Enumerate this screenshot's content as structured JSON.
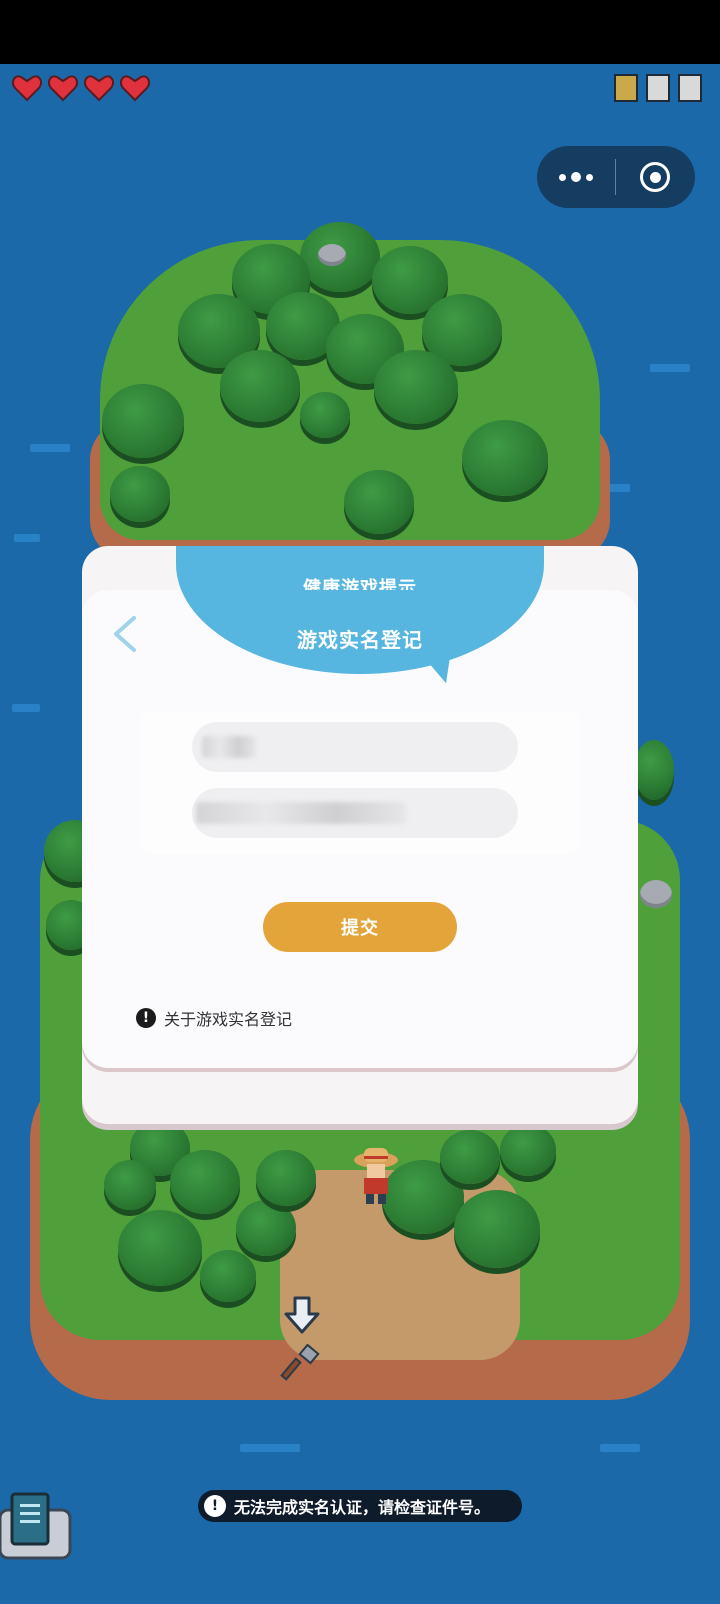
{
  "status": {
    "hearts": 4,
    "heart_color": "#e0323c"
  },
  "menu_capsule": {
    "more_icon": "more-dots-icon",
    "close_icon": "target-circle-icon"
  },
  "dialog": {
    "banner_small": "健康游戏提示",
    "banner_title": "游戏实名登记",
    "back_icon": "chevron-left-icon",
    "name_field_value": " ",
    "id_field_value": " ",
    "submit_label": "提交",
    "about_label": "关于游戏实名登记",
    "accent_color": "#56b6df",
    "button_color": "#e3a53a"
  },
  "toast": {
    "message": "无法完成实名认证，请检查证件号。"
  },
  "inventory": {
    "icon": "book-icon"
  }
}
